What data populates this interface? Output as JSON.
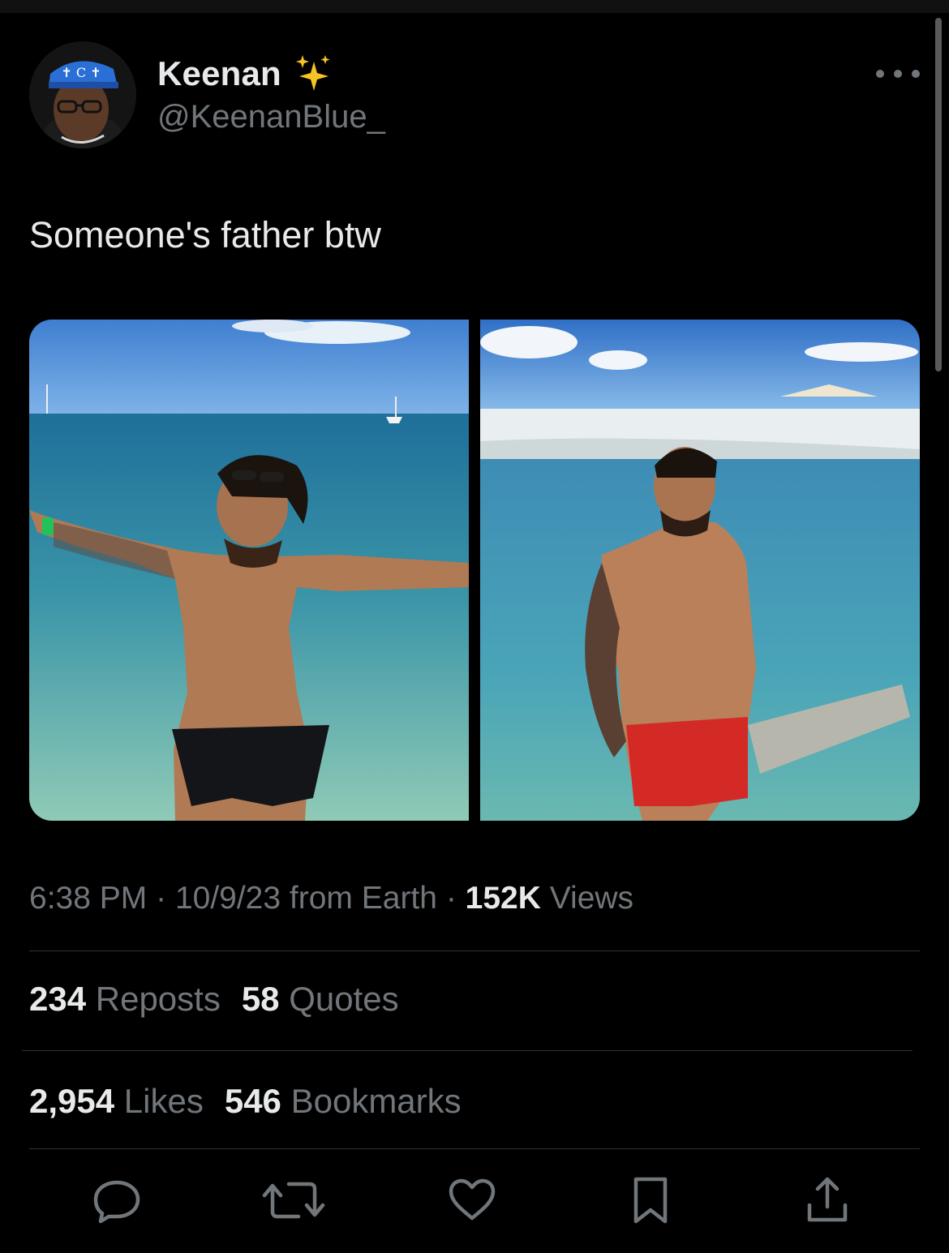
{
  "tweet": {
    "author": {
      "display_name": "Keenan",
      "handle": "@KeenanBlue_",
      "name_emoji": "sparkles-icon"
    },
    "text": "Someone's father btw",
    "time": "6:38 PM",
    "date": "10/9/23",
    "source": "from Earth",
    "separator": "·",
    "views_count": "152K",
    "views_label": "Views"
  },
  "stats": {
    "reposts": {
      "count": "234",
      "label": "Reposts"
    },
    "quotes": {
      "count": "58",
      "label": "Quotes"
    },
    "likes": {
      "count": "2,954",
      "label": "Likes"
    },
    "bookmarks": {
      "count": "546",
      "label": "Bookmarks"
    }
  },
  "actions": [
    "reply-icon",
    "repost-icon",
    "like-icon",
    "bookmark-icon",
    "share-icon"
  ],
  "colors": {
    "background": "#000000",
    "primary_text": "#e7e9ea",
    "secondary_text": "#71767b",
    "divider": "#2f3336"
  }
}
